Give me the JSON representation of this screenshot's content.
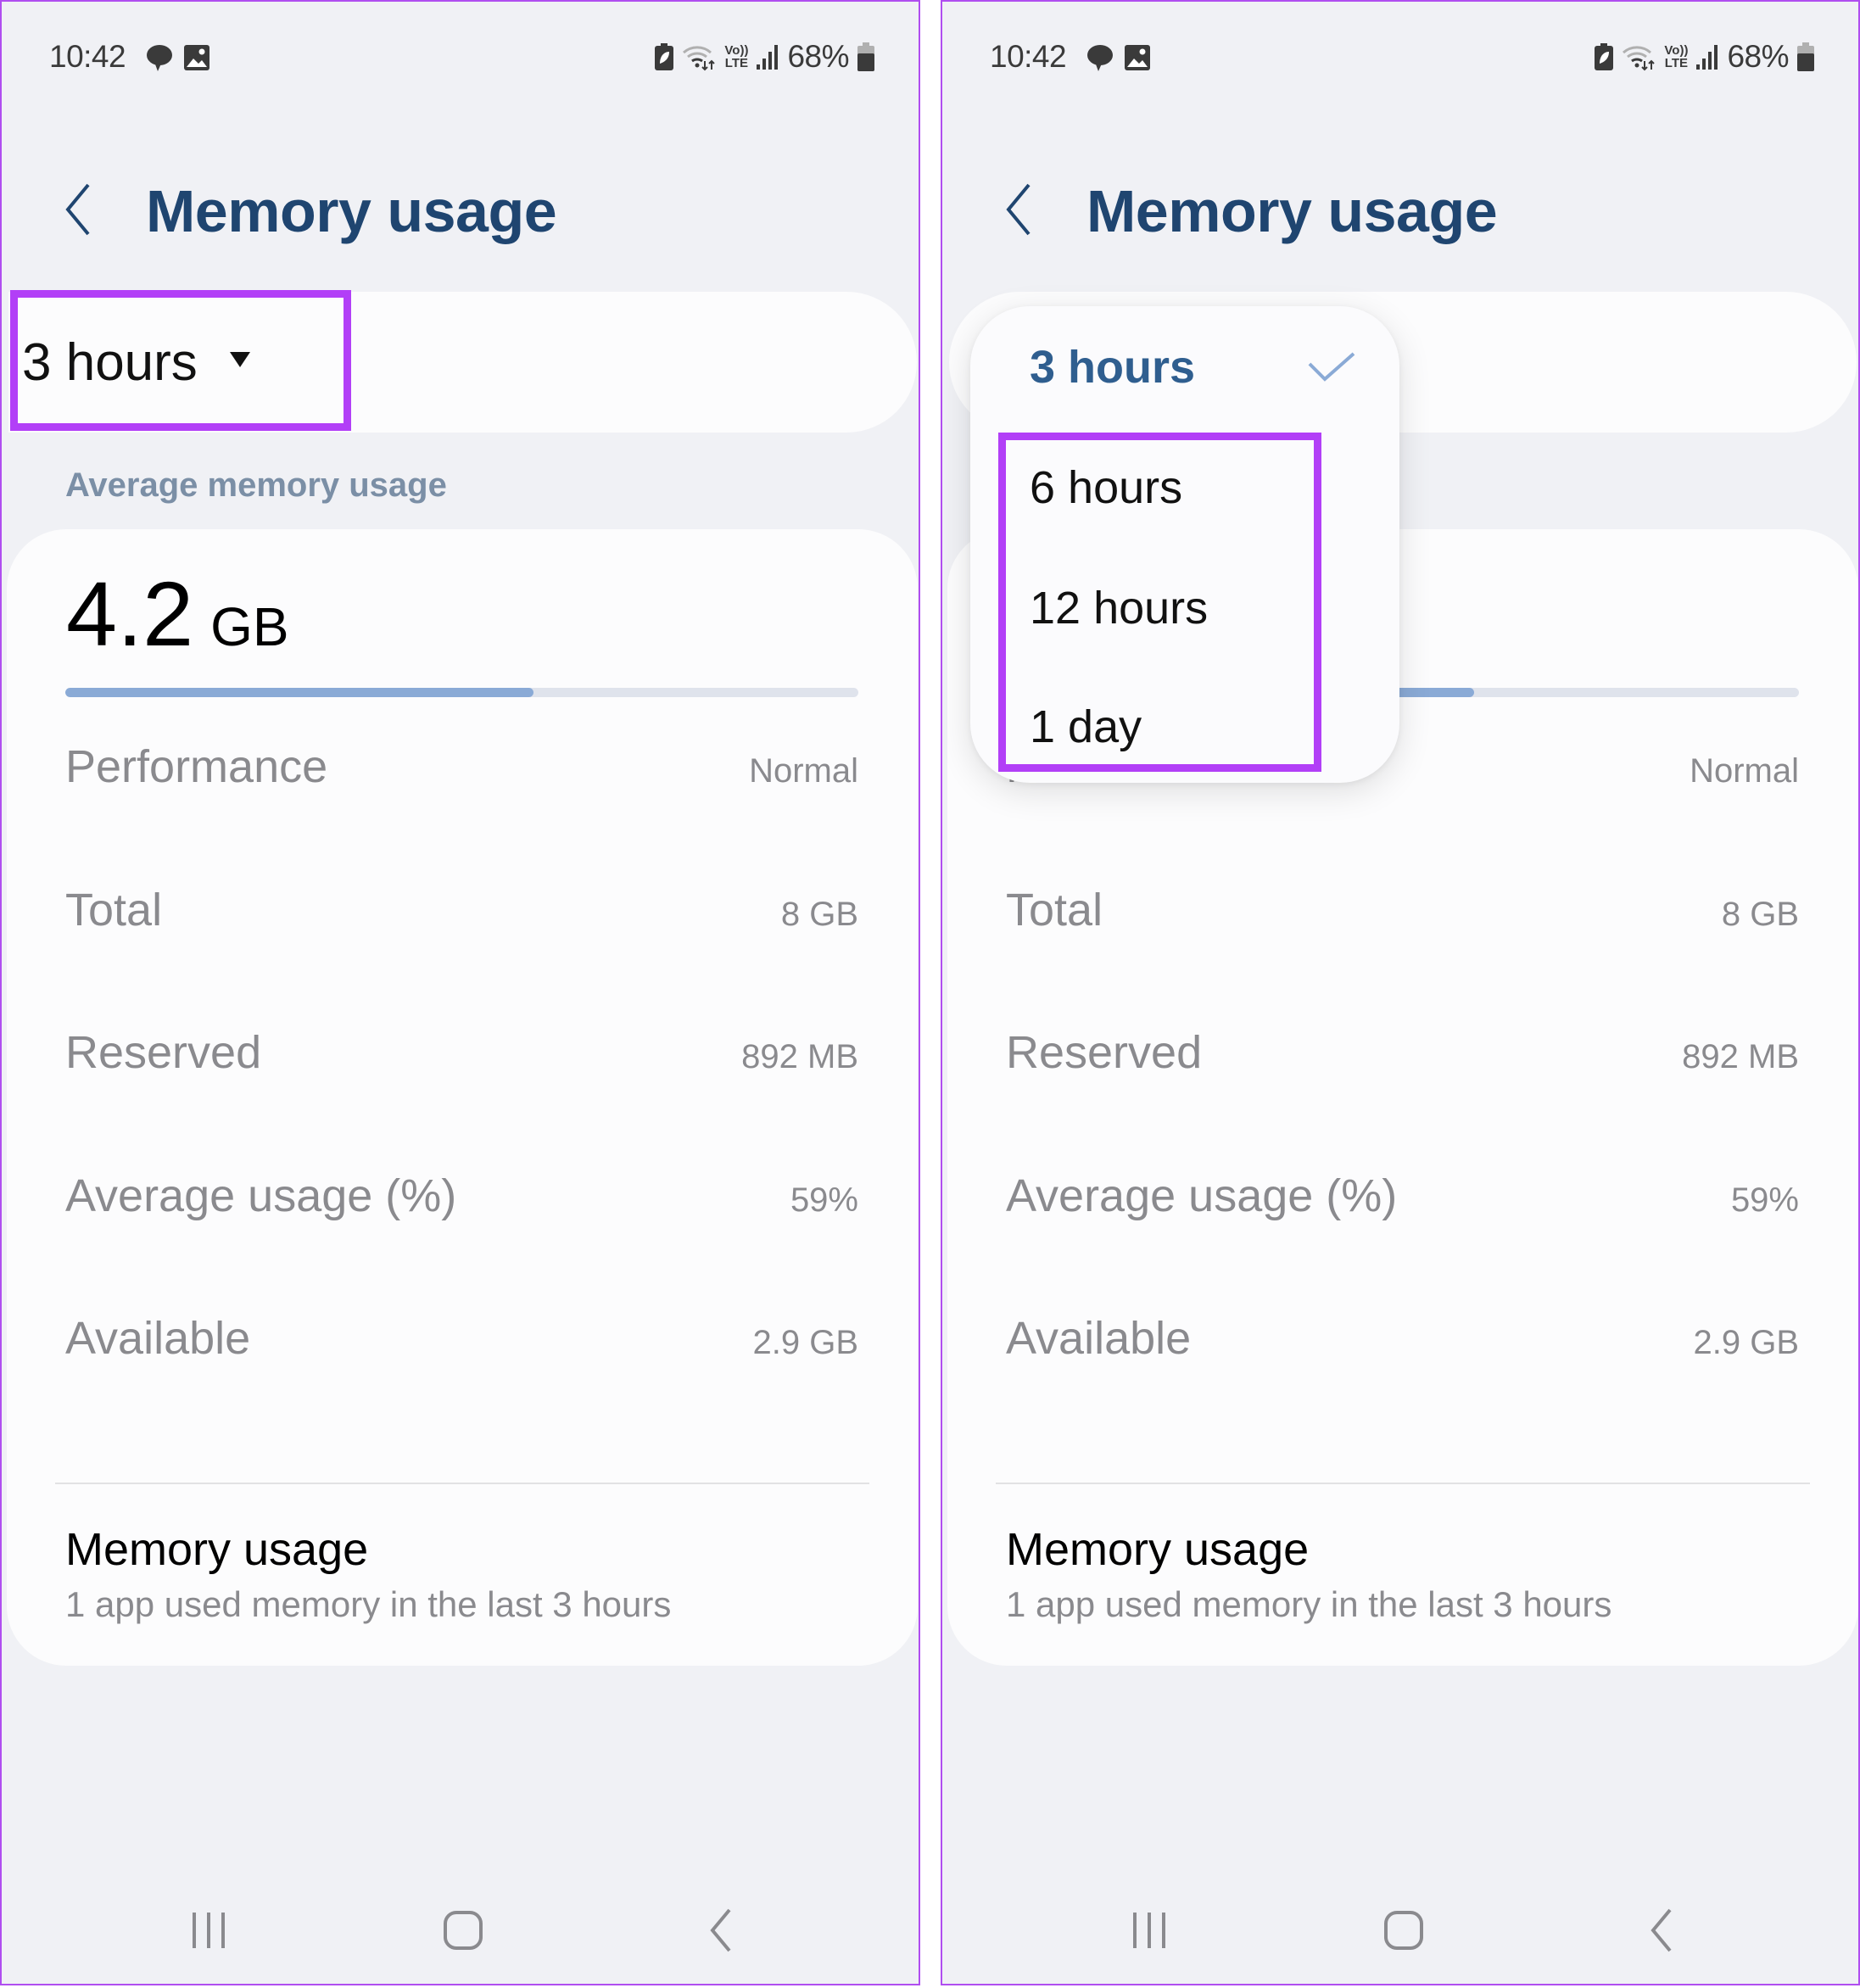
{
  "status_bar": {
    "time": "10:42",
    "left_icons": [
      "chat-bubble-icon",
      "gallery-image-icon"
    ],
    "right_icons": [
      "battery-saver-icon",
      "wifi-icon",
      "volte-lte-icon",
      "signal-icon",
      "battery-icon"
    ],
    "volte_top": "Vo))",
    "volte_bottom": "LTE",
    "battery_percent": "68%"
  },
  "header": {
    "back_icon": "back-chevron-icon",
    "title": "Memory usage"
  },
  "range_selector": {
    "selected": "3 hours",
    "options": [
      "3 hours",
      "6 hours",
      "12 hours",
      "1 day"
    ]
  },
  "section_label": "Average memory usage",
  "summary": {
    "value": "4.2",
    "unit": "GB",
    "usage_fraction": 0.59
  },
  "stats": [
    {
      "label": "Performance",
      "value": "Normal"
    },
    {
      "label": "Total",
      "value": "8 GB"
    },
    {
      "label": "Reserved",
      "value": "892 MB"
    },
    {
      "label": "Average usage (%)",
      "value": "59%"
    },
    {
      "label": "Available",
      "value": "2.9 GB"
    }
  ],
  "memory_usage_link": {
    "title": "Memory usage",
    "subtitle": "1 app used memory in the last 3 hours"
  },
  "nav_bar": {
    "buttons": [
      "recent-apps-icon",
      "home-icon",
      "back-icon"
    ]
  },
  "colors": {
    "title": "#1f4570",
    "accent": "#8aaad6",
    "annotation": "#b23ff7",
    "background": "#f0f1f5"
  }
}
